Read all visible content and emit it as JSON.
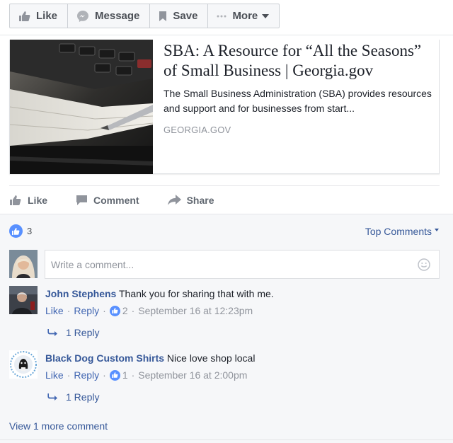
{
  "toolbar": {
    "like_label": "Like",
    "message_label": "Message",
    "save_label": "Save",
    "more_label": "More"
  },
  "link_card": {
    "title": "SBA: A Resource for “All the Seasons” of Small Business | Georgia.gov",
    "description": "The Small Business Administration (SBA) provides resources and support and for businesses from start...",
    "domain": "GEORGIA.GOV"
  },
  "post_actions": {
    "like_label": "Like",
    "comment_label": "Comment",
    "share_label": "Share"
  },
  "reactions": {
    "count": "3"
  },
  "sort": {
    "label": "Top Comments"
  },
  "compose": {
    "placeholder": "Write a comment..."
  },
  "comments": [
    {
      "author": "John Stephens",
      "text": "Thank you for sharing that with me.",
      "like_label": "Like",
      "reply_label": "Reply",
      "likes": "2",
      "timestamp": "September 16 at 12:23pm",
      "replies_label": "1 Reply"
    },
    {
      "author": "Black Dog Custom Shirts",
      "text": "Nice love shop local",
      "like_label": "Like",
      "reply_label": "Reply",
      "likes": "1",
      "timestamp": "September 16 at 2:00pm",
      "replies_label": "1 Reply"
    }
  ],
  "view_more": {
    "label": "View 1 more comment"
  },
  "colors": {
    "link_blue": "#365899",
    "like_blue": "#5890ff",
    "muted_gray": "#90949c",
    "comments_bg": "#f6f7f9"
  }
}
